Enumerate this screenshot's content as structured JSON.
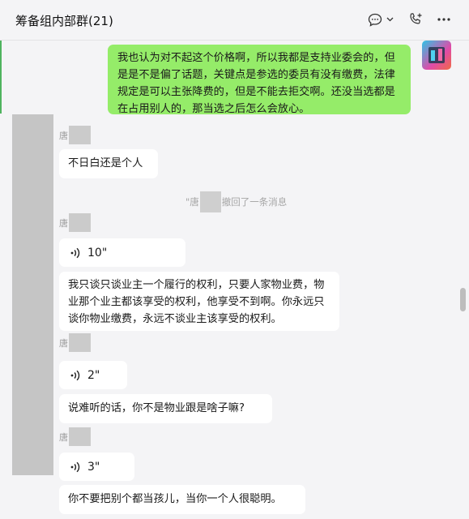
{
  "header": {
    "title": "筹备组内部群(21)",
    "icons": [
      "chat-bubble-icon",
      "chevron-down-icon",
      "phone-add-icon",
      "more-icon"
    ]
  },
  "messages": {
    "out_1": "我也认为对不起这个价格啊，所以我都是支持业委会的，但是是不是偏了话题，关键点是参选的委员有没有缴费，法律规定是可以主张降费的，但是不能去拒交啊。还没当选都是在占用别人的，那当选之后怎么会放心。",
    "sender_prefix": "唐",
    "in_1": "不日白还是个人",
    "recall_prefix": "\"唐",
    "recall_suffix": "撤回了一条消息",
    "voice_1": "10\"",
    "in_2": "我只谈只谈业主一个履行的权利，只要人家物业费，物业那个业主都该享受的权利，他享受不到啊。你永远只谈你物业缴费，永远不谈业主该享受的权利。",
    "voice_2": "2\"",
    "in_3": "说难听的话，你不是物业跟是啥子嘛?",
    "voice_3": "3\"",
    "in_4": "你不要把别个都当孩儿，当你一个人很聪明。"
  },
  "colors": {
    "accent_green": "#95ec69",
    "background": "#f4f4f6"
  }
}
